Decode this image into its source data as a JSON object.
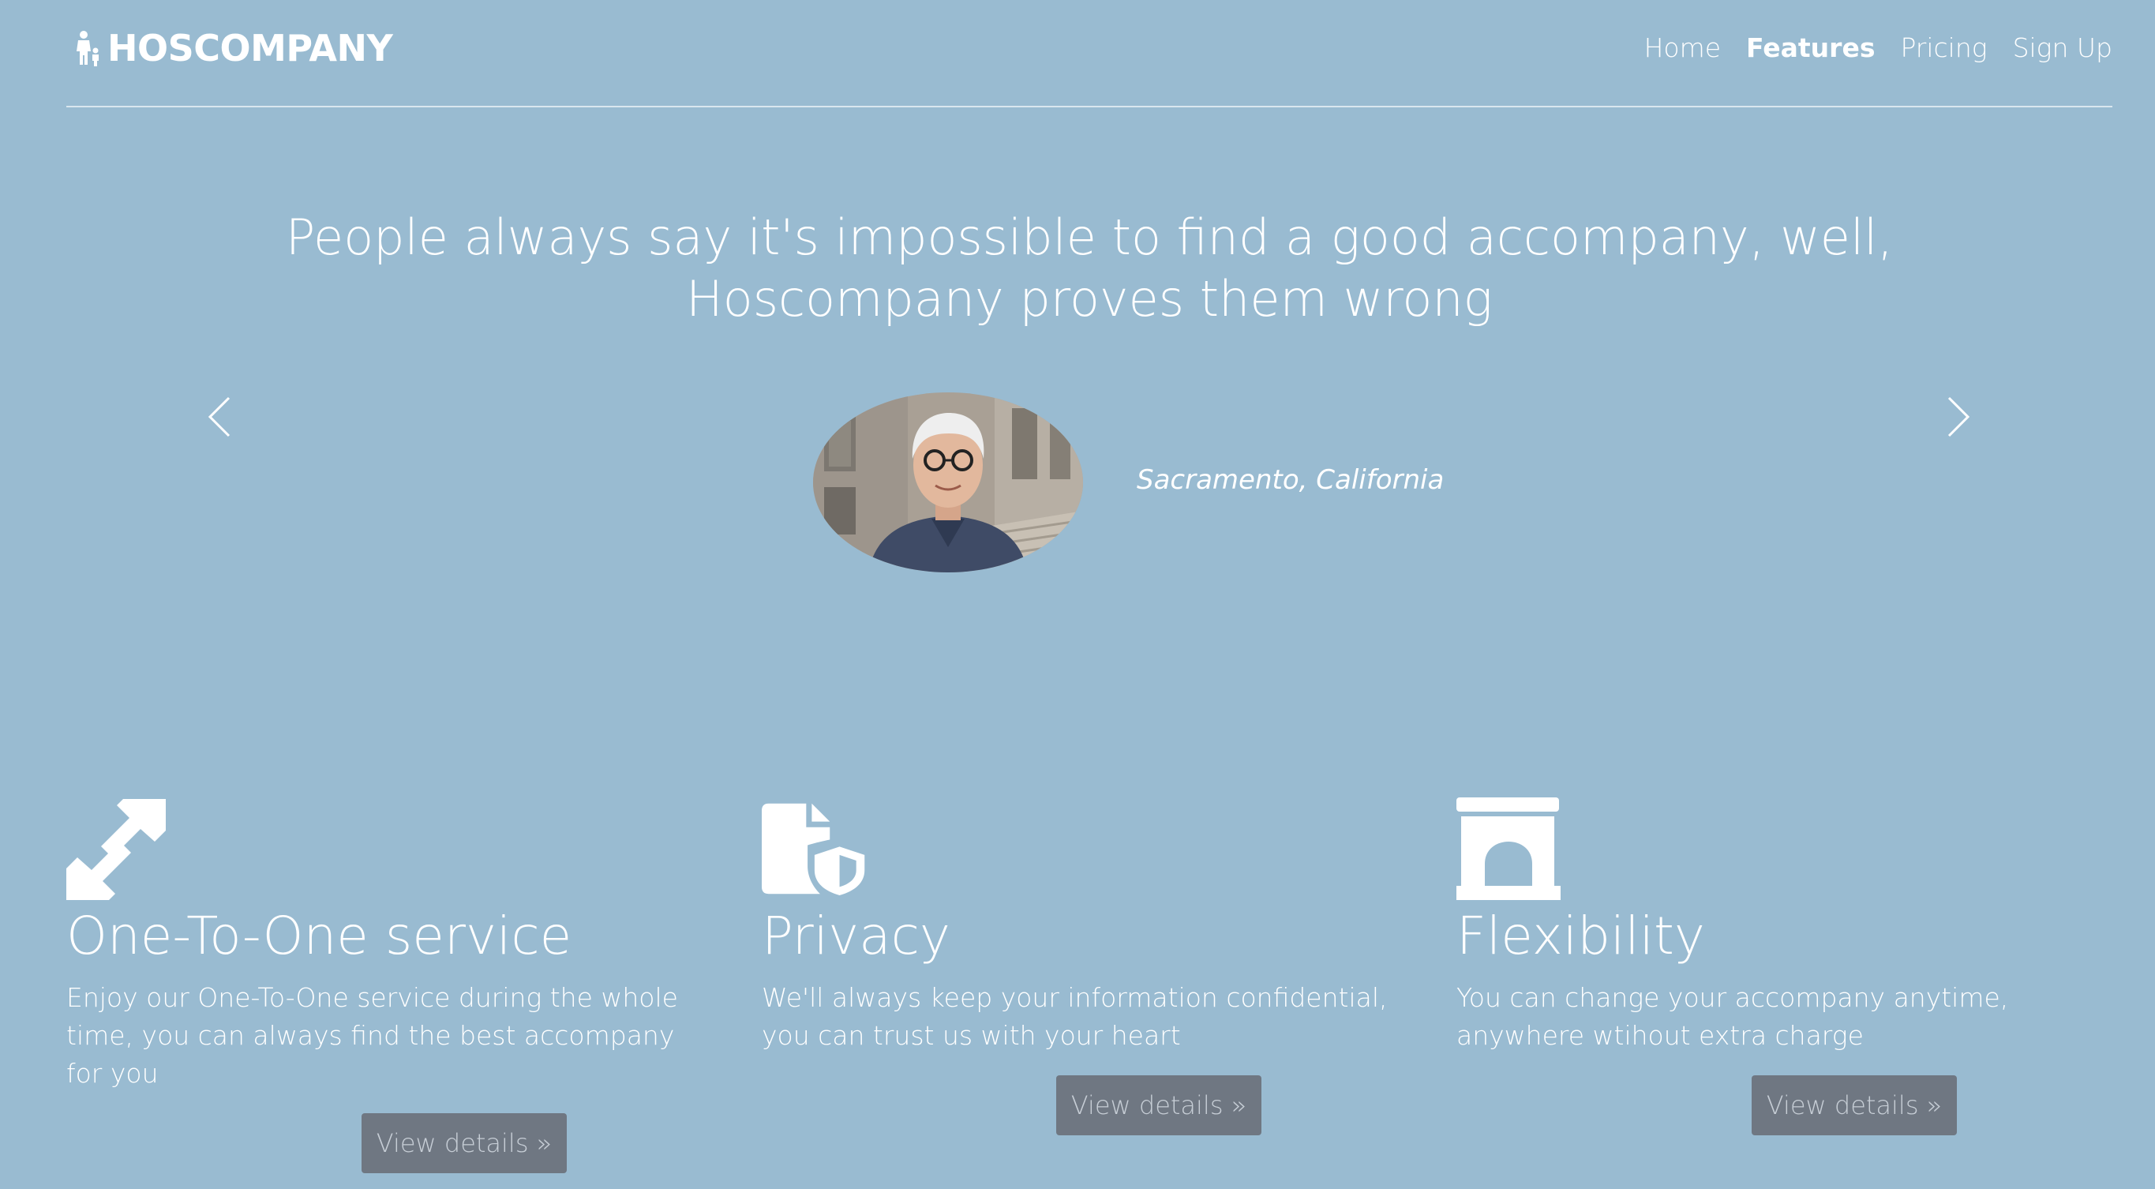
{
  "header": {
    "brand": "HOSCOMPANY",
    "brand_icon": "person-with-child-icon",
    "nav": {
      "home": "Home",
      "features": "Features",
      "pricing": "Pricing",
      "signup": "Sign Up",
      "active": "Features"
    }
  },
  "hero": {
    "quote_line1": "People always say it's impossible to find a good accompany, well,",
    "quote_line2": "Hoscompany proves them wrong",
    "location": "Sacramento, California",
    "prev_icon": "chevron-left-icon",
    "next_icon": "chevron-right-icon",
    "avatar_icon": "testimonial-avatar"
  },
  "features": [
    {
      "icon": "expand-arrows-icon",
      "title": "One-To-One service",
      "text": "Enjoy our One-To-One service during the whole time, you can always find the best accompany for you",
      "button": "View details »"
    },
    {
      "icon": "document-shield-icon",
      "title": "Privacy",
      "text": "We'll always keep your information confidential, you can trust us with your heart",
      "button": "View details »"
    },
    {
      "icon": "archway-icon",
      "title": "Flexibility",
      "text": "You can change your accompany anytime, anywhere wtihout extra charge",
      "button": "View details »"
    }
  ],
  "colors": {
    "background": "#99bbd1",
    "text": "#ffffff",
    "button_bg": "#6f7782",
    "button_text": "#c7ced6"
  }
}
